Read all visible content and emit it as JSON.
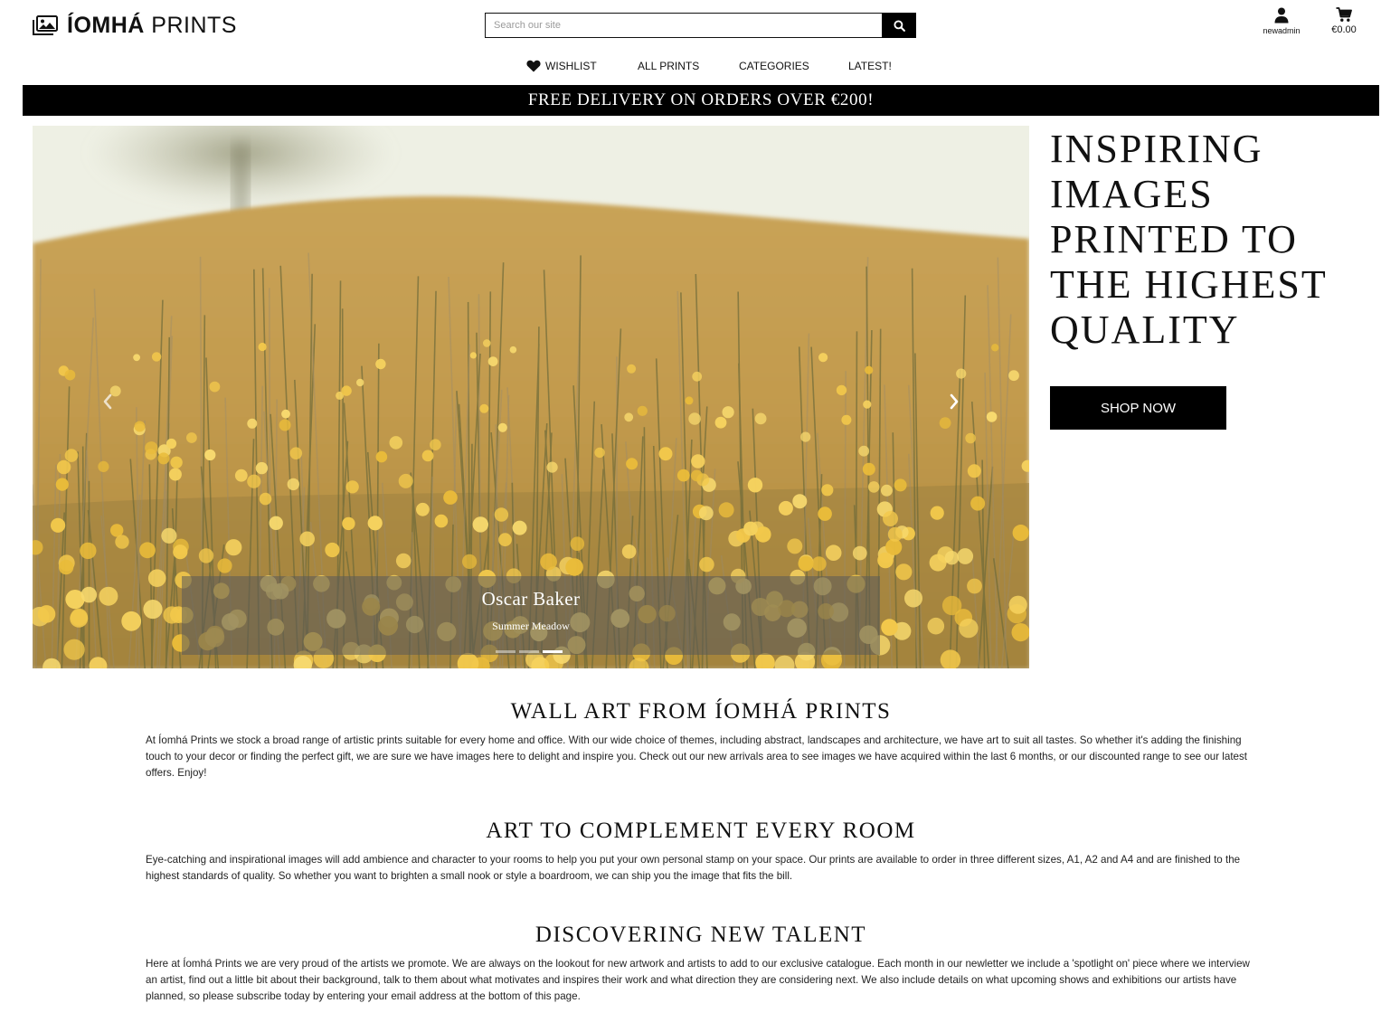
{
  "brand": {
    "name_part1": "ÍOMHÁ",
    "name_part2": "PRINTS"
  },
  "search": {
    "placeholder": "Search our site"
  },
  "account": {
    "label": "newadmin"
  },
  "cart": {
    "total": "€0.00"
  },
  "nav": {
    "wishlist": "WISHLIST",
    "all_prints": "ALL PRINTS",
    "categories": "CATEGORIES",
    "latest": "LATEST!"
  },
  "banner": {
    "text": "FREE DELIVERY ON ORDERS OVER €200!"
  },
  "hero": {
    "title": "INSPIRING IMAGES PRINTED TO THE HIGHEST QUALITY",
    "cta": "SHOP NOW",
    "slide": {
      "artist": "Oscar Baker",
      "title": "Summer Meadow"
    },
    "slide_count": 3,
    "active_slide": 3
  },
  "sections": [
    {
      "heading": "WALL ART FROM ÍOMHÁ PRINTS",
      "body": "At Íomhá Prints we stock a broad range of artistic prints suitable for every home and office. With our wide choice of themes, including abstract, landscapes and architecture, we have art to suit all tastes. So whether it's adding the finishing touch to your decor or finding the perfect gift, we are sure we have images here to delight and inspire you. Check out our new arrivals area to see images we have acquired within the last 6 months, or our discounted range to see our latest offers. Enjoy!"
    },
    {
      "heading": "ART TO COMPLEMENT EVERY ROOM",
      "body": "Eye-catching and inspirational images will add ambience and character to your rooms to help you put your own personal stamp on your space. Our prints are available to order in three different sizes, A1, A2 and A4 and are finished to the highest standards of quality. So whether you want to brighten a small nook or style a boardroom, we can ship you the image that fits the bill."
    },
    {
      "heading": "DISCOVERING NEW TALENT",
      "body": "Here at Íomhá Prints we are very proud of the artists we promote. We are always on the lookout for new artwork and artists to add to our exclusive catalogue. Each month in our newletter we include a 'spotlight on' piece where we interview an artist, find out a little bit about their background, talk to them about what motivates and inspires their work and what direction they are considering next. We also include details on what upcoming shows and exhibitions our artists have planned, so please subscribe today by entering your email address at the bottom of this page."
    }
  ],
  "icons": {
    "logo": "images-icon",
    "search": "search-icon",
    "account": "user-icon",
    "cart": "cart-icon",
    "wishlist": "heart-icon",
    "prev": "chevron-left-icon",
    "next": "chevron-right-icon"
  },
  "colors": {
    "primary": "#000000",
    "background": "#ffffff",
    "text": "#111111"
  }
}
